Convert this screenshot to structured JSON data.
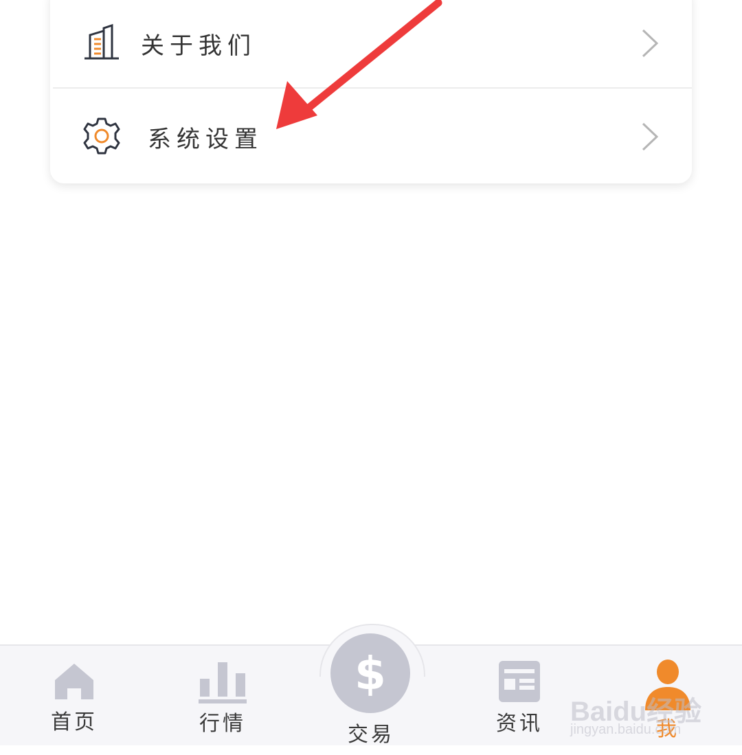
{
  "menu": {
    "items": [
      {
        "label": "关于我们",
        "icon": "building-icon"
      },
      {
        "label": "系统设置",
        "icon": "gear-icon"
      }
    ]
  },
  "tabbar": {
    "tabs": [
      {
        "label": "首页",
        "icon": "home-icon"
      },
      {
        "label": "行情",
        "icon": "bar-chart-icon"
      },
      {
        "label": "交易",
        "icon": "dollar-icon"
      },
      {
        "label": "资讯",
        "icon": "news-icon"
      },
      {
        "label": "我",
        "icon": "person-icon"
      }
    ],
    "active_tab": "我",
    "trade_symbol": "$"
  },
  "colors": {
    "accent": "#f08a2b",
    "inactive_icon": "#c5c6d1",
    "annotation_arrow": "#ee3b3b"
  },
  "watermark": {
    "brand": "Baidu经验",
    "url": "jingyan.baidu.com"
  }
}
